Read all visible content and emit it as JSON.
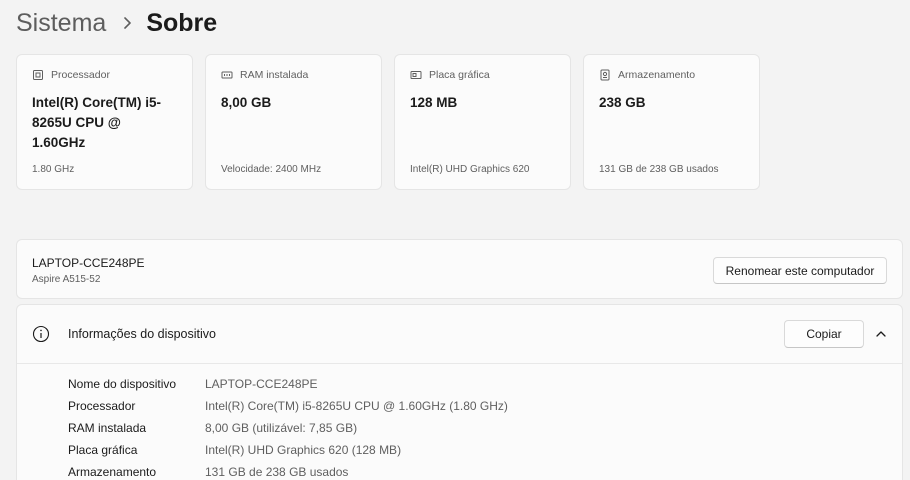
{
  "breadcrumb": {
    "parent": "Sistema",
    "current": "Sobre"
  },
  "cards": [
    {
      "icon": "processor-icon",
      "title": "Processador",
      "value": "Intel(R) Core(TM) i5-8265U CPU @ 1.60GHz",
      "sub": "1.80 GHz"
    },
    {
      "icon": "ram-icon",
      "title": "RAM instalada",
      "value": "8,00 GB",
      "sub": "Velocidade: 2400 MHz"
    },
    {
      "icon": "gpu-icon",
      "title": "Placa gráfica",
      "value": "128 MB",
      "sub": "Intel(R) UHD Graphics 620"
    },
    {
      "icon": "storage-icon",
      "title": "Armazenamento",
      "value": "238 GB",
      "sub": "131 GB de 238 GB usados"
    }
  ],
  "device": {
    "name": "LAPTOP-CCE248PE",
    "model": "Aspire A515-52",
    "rename_label": "Renomear este computador"
  },
  "info": {
    "title": "Informações do dispositivo",
    "copy_label": "Copiar",
    "specs": [
      {
        "label": "Nome do dispositivo",
        "value": "LAPTOP-CCE248PE"
      },
      {
        "label": "Processador",
        "value": "Intel(R) Core(TM) i5-8265U CPU @ 1.60GHz (1.80 GHz)"
      },
      {
        "label": "RAM instalada",
        "value": "8,00 GB (utilizável: 7,85 GB)"
      },
      {
        "label": "Placa gráfica",
        "value": "Intel(R) UHD Graphics 620 (128 MB)"
      },
      {
        "label": "Armazenamento",
        "value": "131 GB de 238 GB usados"
      }
    ]
  }
}
